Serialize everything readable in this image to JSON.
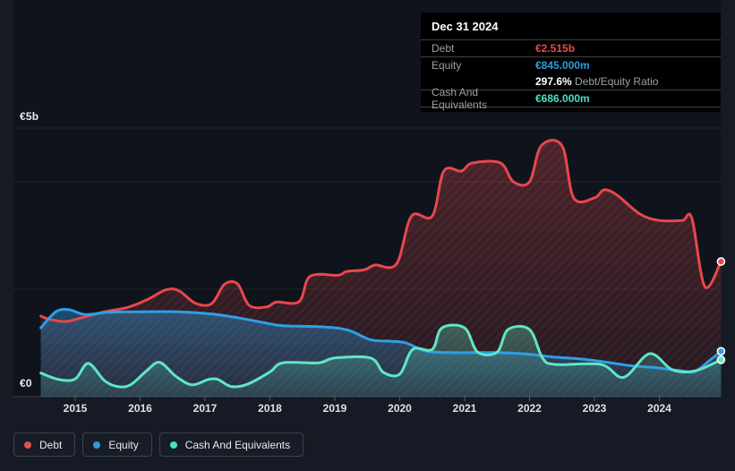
{
  "tooltip": {
    "date": "Dec 31 2024",
    "debt_label": "Debt",
    "debt_value": "€2.515b",
    "debt_color": "#e8484e",
    "equity_label": "Equity",
    "equity_value": "€845.000m",
    "equity_color": "#2d9cdb",
    "ratio_value": "297.6%",
    "ratio_label": "Debt/Equity Ratio",
    "cash_label": "Cash And Equivalents",
    "cash_value": "€686.000m",
    "cash_color": "#4ce0c3"
  },
  "legend": {
    "items": [
      {
        "label": "Debt",
        "color": "#e05252"
      },
      {
        "label": "Equity",
        "color": "#2d9cdb"
      },
      {
        "label": "Cash And Equivalents",
        "color": "#4ce0c3"
      }
    ]
  },
  "axis": {
    "y_top_label": "€5b",
    "y_zero_label": "€0",
    "years": [
      "2015",
      "2016",
      "2017",
      "2018",
      "2019",
      "2020",
      "2021",
      "2022",
      "2023",
      "2024"
    ]
  },
  "colors": {
    "page_bg": "#151a24",
    "plot_bg": "#0f141c",
    "gridline": "rgba(255,255,255,0.07)",
    "axis_line": "rgba(255,255,255,0.18)"
  },
  "chart_data": {
    "type": "area",
    "title": "Debt to Equity History and Analysis",
    "x_unit": "year",
    "x_range": [
      2014.47,
      2024.95
    ],
    "ylim": [
      0,
      5
    ],
    "y_currency": "EUR billions",
    "gridlines_at_b": [
      5,
      4,
      2,
      0
    ],
    "legend_position": "bottom-left",
    "series": [
      {
        "name": "Debt",
        "color": "#e8474d",
        "end_value_b": 2.515,
        "points": [
          [
            2014.47,
            1.5
          ],
          [
            2014.6,
            1.44
          ],
          [
            2014.85,
            1.4
          ],
          [
            2015.1,
            1.47
          ],
          [
            2015.45,
            1.58
          ],
          [
            2015.8,
            1.66
          ],
          [
            2016.1,
            1.8
          ],
          [
            2016.4,
            1.99
          ],
          [
            2016.6,
            1.97
          ],
          [
            2016.85,
            1.74
          ],
          [
            2017.1,
            1.73
          ],
          [
            2017.3,
            2.09
          ],
          [
            2017.5,
            2.1
          ],
          [
            2017.68,
            1.7
          ],
          [
            2017.95,
            1.67
          ],
          [
            2018.1,
            1.76
          ],
          [
            2018.45,
            1.77
          ],
          [
            2018.62,
            2.24
          ],
          [
            2019.05,
            2.26
          ],
          [
            2019.18,
            2.33
          ],
          [
            2019.45,
            2.36
          ],
          [
            2019.62,
            2.45
          ],
          [
            2019.95,
            2.47
          ],
          [
            2020.18,
            3.36
          ],
          [
            2020.5,
            3.36
          ],
          [
            2020.68,
            4.2
          ],
          [
            2020.95,
            4.2
          ],
          [
            2021.12,
            4.35
          ],
          [
            2021.55,
            4.35
          ],
          [
            2021.75,
            4.0
          ],
          [
            2022.0,
            4.0
          ],
          [
            2022.18,
            4.67
          ],
          [
            2022.5,
            4.67
          ],
          [
            2022.68,
            3.7
          ],
          [
            2023.0,
            3.7
          ],
          [
            2023.15,
            3.85
          ],
          [
            2023.35,
            3.75
          ],
          [
            2023.7,
            3.4
          ],
          [
            2024.0,
            3.28
          ],
          [
            2024.35,
            3.28
          ],
          [
            2024.5,
            3.32
          ],
          [
            2024.7,
            2.05
          ],
          [
            2024.95,
            2.515
          ]
        ]
      },
      {
        "name": "Equity",
        "color": "#2e9fe6",
        "end_value_b": 0.845,
        "points": [
          [
            2014.47,
            1.28
          ],
          [
            2014.7,
            1.58
          ],
          [
            2014.9,
            1.62
          ],
          [
            2015.15,
            1.53
          ],
          [
            2015.5,
            1.57
          ],
          [
            2016.0,
            1.58
          ],
          [
            2016.6,
            1.58
          ],
          [
            2017.1,
            1.54
          ],
          [
            2017.5,
            1.47
          ],
          [
            2017.9,
            1.38
          ],
          [
            2018.2,
            1.32
          ],
          [
            2018.8,
            1.3
          ],
          [
            2019.2,
            1.24
          ],
          [
            2019.55,
            1.06
          ],
          [
            2019.9,
            1.03
          ],
          [
            2020.1,
            1.0
          ],
          [
            2020.4,
            0.85
          ],
          [
            2020.8,
            0.82
          ],
          [
            2021.5,
            0.82
          ],
          [
            2022.0,
            0.79
          ],
          [
            2022.35,
            0.74
          ],
          [
            2022.8,
            0.7
          ],
          [
            2023.2,
            0.64
          ],
          [
            2023.6,
            0.57
          ],
          [
            2023.95,
            0.54
          ],
          [
            2024.35,
            0.48
          ],
          [
            2024.55,
            0.47
          ],
          [
            2024.8,
            0.7
          ],
          [
            2024.95,
            0.845
          ]
        ]
      },
      {
        "name": "Cash And Equivalents",
        "color": "#5fe6c6",
        "end_value_b": 0.686,
        "points": [
          [
            2014.47,
            0.44
          ],
          [
            2014.75,
            0.32
          ],
          [
            2015.0,
            0.33
          ],
          [
            2015.2,
            0.62
          ],
          [
            2015.45,
            0.3
          ],
          [
            2015.65,
            0.19
          ],
          [
            2015.85,
            0.22
          ],
          [
            2016.1,
            0.48
          ],
          [
            2016.3,
            0.64
          ],
          [
            2016.55,
            0.38
          ],
          [
            2016.8,
            0.22
          ],
          [
            2017.05,
            0.32
          ],
          [
            2017.2,
            0.32
          ],
          [
            2017.4,
            0.19
          ],
          [
            2017.65,
            0.23
          ],
          [
            2018.0,
            0.46
          ],
          [
            2018.2,
            0.63
          ],
          [
            2018.75,
            0.63
          ],
          [
            2019.0,
            0.72
          ],
          [
            2019.55,
            0.72
          ],
          [
            2019.75,
            0.45
          ],
          [
            2020.0,
            0.42
          ],
          [
            2020.2,
            0.88
          ],
          [
            2020.5,
            0.88
          ],
          [
            2020.65,
            1.28
          ],
          [
            2021.0,
            1.28
          ],
          [
            2021.2,
            0.83
          ],
          [
            2021.5,
            0.83
          ],
          [
            2021.67,
            1.25
          ],
          [
            2022.0,
            1.25
          ],
          [
            2022.2,
            0.72
          ],
          [
            2022.4,
            0.6
          ],
          [
            2023.1,
            0.6
          ],
          [
            2023.45,
            0.36
          ],
          [
            2023.85,
            0.8
          ],
          [
            2024.2,
            0.5
          ],
          [
            2024.55,
            0.48
          ],
          [
            2024.95,
            0.686
          ]
        ]
      }
    ]
  }
}
